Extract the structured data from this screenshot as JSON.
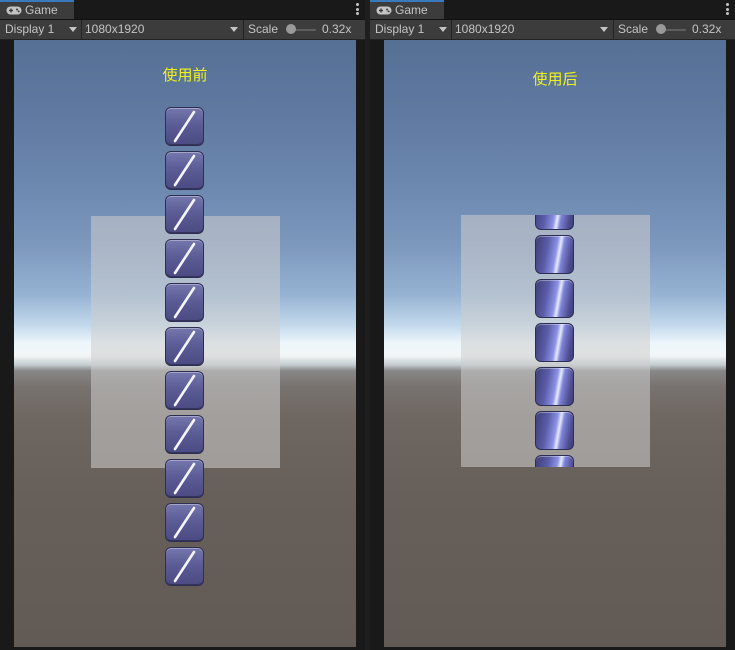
{
  "left_panel": {
    "tab_label": "Game",
    "display": "Display 1",
    "resolution": "1080x1920",
    "scale_label": "Scale",
    "scale_value": "0.32x",
    "heading": "使用前",
    "tile_style": "diagonal-stroke",
    "tile_count": 11
  },
  "right_panel": {
    "tab_label": "Game",
    "display": "Display 1",
    "resolution": "1080x1920",
    "scale_label": "Scale",
    "scale_value": "0.32x",
    "heading": "使用后",
    "tile_style": "metallic-sheen",
    "tile_count": 7
  },
  "colors": {
    "heading": "#f2f21a",
    "tile_base": "#5c5c96",
    "tab_accent": "#3a79bb"
  },
  "icons": [
    "gamepad-icon",
    "kebab-menu-icon",
    "dropdown-caret-icon",
    "slider-knob-icon"
  ]
}
